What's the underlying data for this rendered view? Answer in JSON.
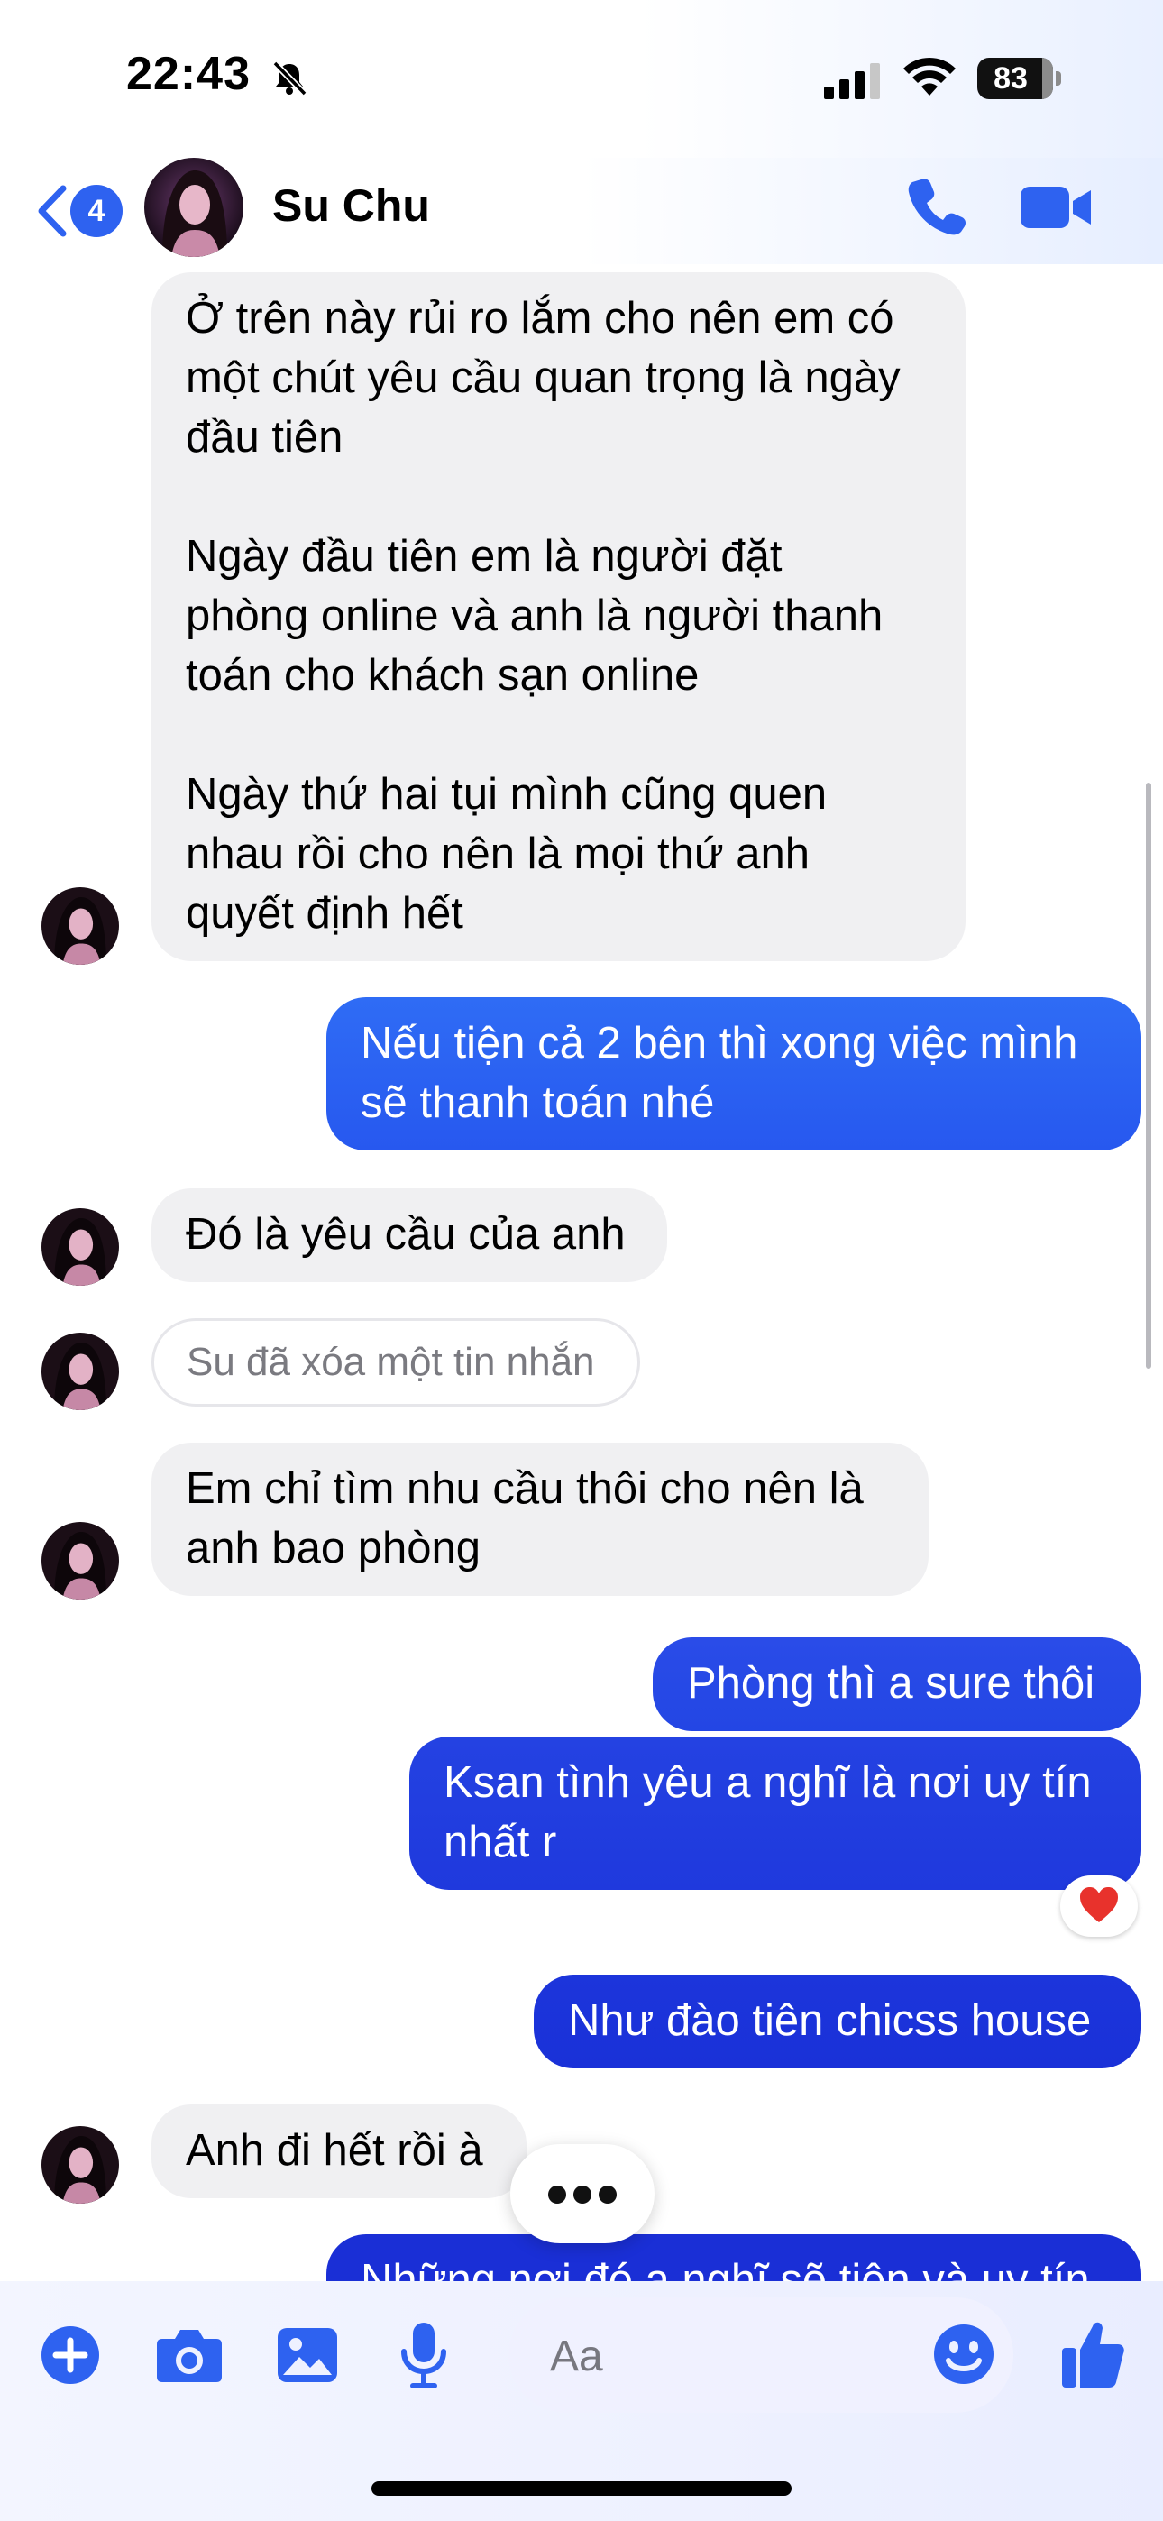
{
  "status_bar": {
    "time": "22:43",
    "battery": "83"
  },
  "header": {
    "unread_count": "4",
    "contact_name": "Su Chu"
  },
  "messages": [
    {
      "from": "contact",
      "text": "Ở trên này rủi ro lắm cho nên em có\nmột chút yêu cầu quan trọng là ngày\nđầu tiên\n\nNgày đầu tiên em là người đặt\nphòng online và anh là người thanh\ntoán cho khách sạn online\n\nNgày thứ hai tụi mình cũng quen\nnhau rồi cho nên là mọi thứ anh\nquyết định hết"
    },
    {
      "from": "me",
      "text": "Nếu tiện cả 2 bên thì xong việc mình\nsẽ thanh toán nhé"
    },
    {
      "from": "contact",
      "text": "Đó là yêu cầu của anh"
    },
    {
      "from": "contact",
      "deleted": true,
      "text": "Su đã xóa một tin nhắn"
    },
    {
      "from": "contact",
      "text": "Em chỉ tìm nhu cầu thôi cho nên là\nanh bao phòng"
    },
    {
      "from": "me",
      "text": "Phòng thì a sure thôi"
    },
    {
      "from": "me",
      "text": "Ksan tình yêu a nghĩ là nơi uy tín\nnhất r",
      "reaction": "heart"
    },
    {
      "from": "me",
      "text": "Như đào tiên chicss house"
    },
    {
      "from": "contact",
      "text": "Anh đi hết rồi à"
    },
    {
      "from": "me",
      "text": "Những nơi đó a nghĩ sẽ tiện và uy tín"
    }
  ],
  "composer": {
    "placeholder": "Aa",
    "icons": [
      "plus-icon",
      "camera-icon",
      "photo-icon",
      "microphone-icon",
      "emoji-icon",
      "thumbs-up-icon"
    ]
  },
  "colors": {
    "accent": "#2e62f0",
    "outgoing_top": "#2f6cf5",
    "outgoing_bottom": "#1b2fd8",
    "incoming": "#f0f0f2"
  }
}
